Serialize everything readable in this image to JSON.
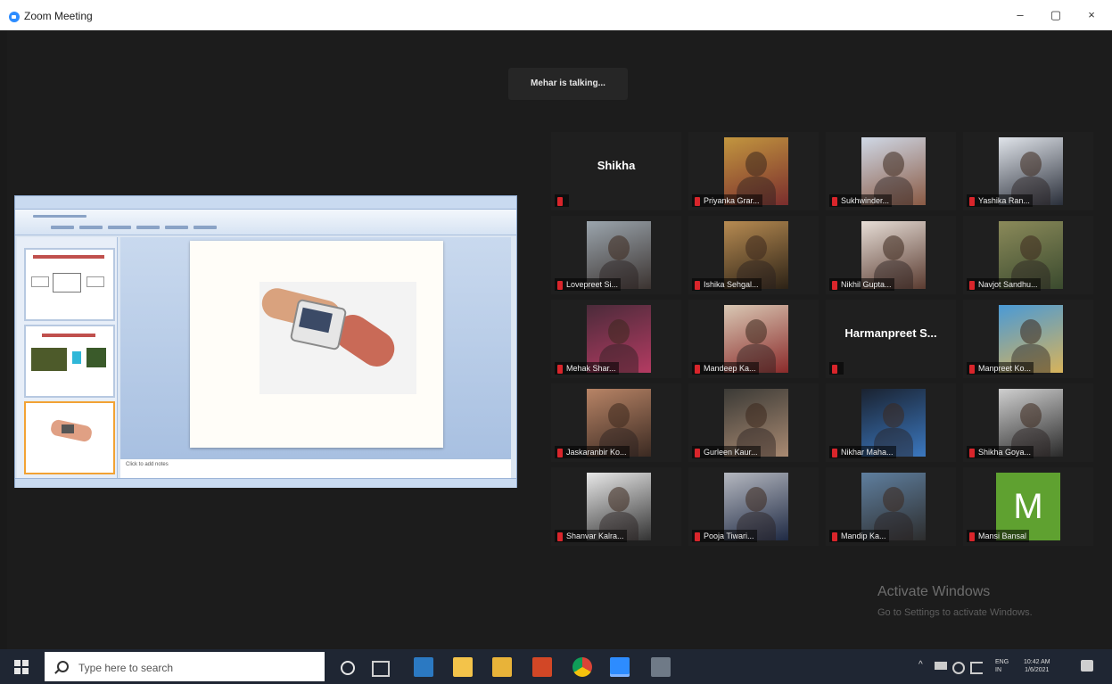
{
  "window": {
    "title": "Zoom Meeting",
    "minimize": "–",
    "maximize": "▢",
    "close": "×"
  },
  "meeting": {
    "talking_indicator": "Mehar is talking...",
    "shared_screen_notes": "Click to add notes"
  },
  "participants": [
    {
      "name": "Shikha",
      "type": "name-only"
    },
    {
      "name": "Priyanka Grar...",
      "type": "video",
      "colors": [
        "#c2963f",
        "#7a2d2d"
      ]
    },
    {
      "name": "Sukhwinder...",
      "type": "video",
      "colors": [
        "#cfd8e6",
        "#8a5a44"
      ]
    },
    {
      "name": "Yashika Ran...",
      "type": "video",
      "colors": [
        "#e0e4ea",
        "#2a2f3a"
      ]
    },
    {
      "name": "Lovepreet Si...",
      "type": "video",
      "colors": [
        "#9ba5ad",
        "#3b3330"
      ]
    },
    {
      "name": "Ishika Sehgal...",
      "type": "video",
      "colors": [
        "#b78b52",
        "#2c2216"
      ]
    },
    {
      "name": "Nikhil Gupta...",
      "type": "video",
      "colors": [
        "#e6ddd6",
        "#5a3b30"
      ]
    },
    {
      "name": "Navjot Sandhu...",
      "type": "video",
      "colors": [
        "#8b8a5a",
        "#3a4a2e"
      ]
    },
    {
      "name": "Mehak Shar...",
      "type": "video",
      "colors": [
        "#4b2b3a",
        "#b43b62"
      ]
    },
    {
      "name": "Mandeep Ka...",
      "type": "video",
      "colors": [
        "#d9c8b4",
        "#8a2a2a"
      ]
    },
    {
      "name": "Harmanpreet S...",
      "type": "name-only"
    },
    {
      "name": "Manpreet Ko...",
      "type": "video",
      "colors": [
        "#4a9ad6",
        "#d8b35a"
      ]
    },
    {
      "name": "Jaskaranbir Ko...",
      "type": "video",
      "colors": [
        "#b88466",
        "#3b2a22"
      ]
    },
    {
      "name": "Gurleen Kaur...",
      "type": "video",
      "colors": [
        "#3b3a36",
        "#a98a72"
      ]
    },
    {
      "name": "Nikhar Maha...",
      "type": "video",
      "colors": [
        "#1a2230",
        "#3b78c0"
      ]
    },
    {
      "name": "Shikha Goya...",
      "type": "video",
      "colors": [
        "#cfcfcf",
        "#2a2a2a"
      ]
    },
    {
      "name": "Shanvar Kalra...",
      "type": "video",
      "colors": [
        "#e8e8e8",
        "#333333"
      ]
    },
    {
      "name": "Pooja Tiwari...",
      "type": "video",
      "colors": [
        "#b5b8c0",
        "#1f2a44"
      ]
    },
    {
      "name": "Mandip Ka...",
      "type": "video",
      "colors": [
        "#5f7f9f",
        "#2d2d2d"
      ]
    },
    {
      "name": "Mansi Bansal",
      "type": "avatar",
      "initial": "M",
      "colors": [
        "#5fa130"
      ]
    }
  ],
  "watermark": {
    "line1": "Activate Windows",
    "line2": "Go to Settings to activate Windows."
  },
  "taskbar": {
    "search_placeholder": "Type here to search",
    "lang": "ENG",
    "lang_region": "IN",
    "time": "10:42 AM",
    "date": "1/6/2021"
  },
  "colors": {
    "meeting_bg": "#1c1c1c",
    "tile_bg": "#1f1f1f",
    "muted_mic": "#d9252b",
    "taskbar_bg": "#1f2633",
    "zoom_blue": "#2d8cff"
  }
}
